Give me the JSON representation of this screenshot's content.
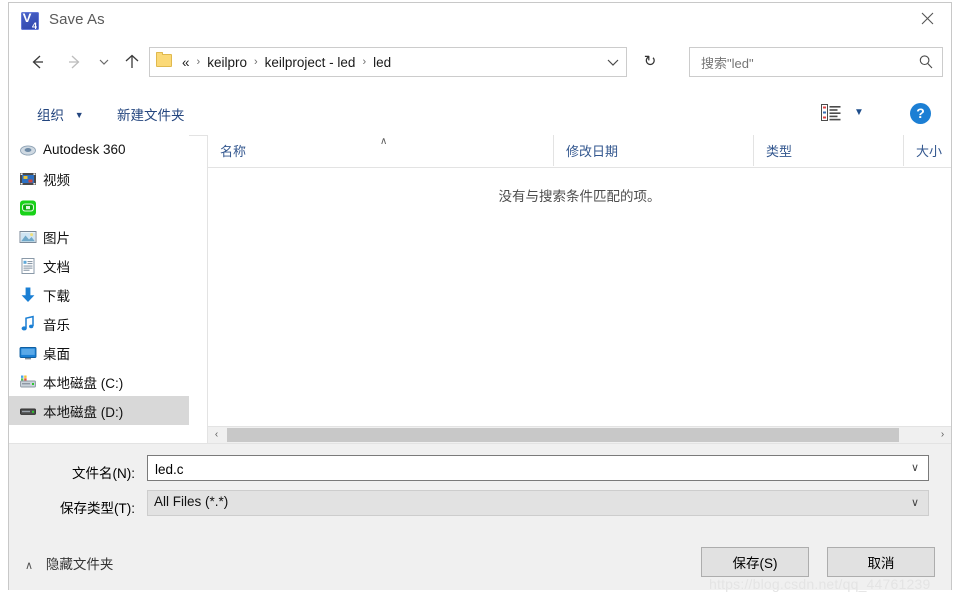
{
  "window": {
    "title": "Save As",
    "app_icon": "keil-uvision-icon",
    "close_label": "✕"
  },
  "nav": {
    "back_icon": "arrow-left-icon",
    "forward_icon": "arrow-right-icon",
    "recent_icon": "chevron-down-icon",
    "up_icon": "arrow-up-icon",
    "refresh_icon": "↻",
    "address_dropdown_icon": "chevron-down-icon",
    "folder_icon": "folder-icon",
    "breadcrumb_prefix": "«",
    "breadcrumb": [
      "keilpro",
      "keilproject - led",
      "led"
    ],
    "breadcrumb_separator": "›"
  },
  "search": {
    "placeholder": "搜索\"led\"",
    "value": "",
    "icon": "search-icon"
  },
  "toolbar": {
    "organize_label": "组织",
    "organize_caret": "▼",
    "new_folder_label": "新建文件夹",
    "view_icon": "list-view-icon",
    "view_caret": "▼",
    "help_label": "?"
  },
  "sidebar": {
    "items": [
      {
        "label": "Autodesk 360",
        "icon": "autodesk-cloud-icon",
        "selected": false
      },
      {
        "label": "视频",
        "icon": "videos-icon",
        "selected": false
      },
      {
        "label": "",
        "icon": "green-app-icon",
        "selected": false
      },
      {
        "label": "图片",
        "icon": "pictures-icon",
        "selected": false
      },
      {
        "label": "文档",
        "icon": "documents-icon",
        "selected": false
      },
      {
        "label": "下载",
        "icon": "downloads-icon",
        "selected": false
      },
      {
        "label": "音乐",
        "icon": "music-icon",
        "selected": false
      },
      {
        "label": "桌面",
        "icon": "desktop-icon",
        "selected": false
      },
      {
        "label": "本地磁盘 (C:)",
        "icon": "system-drive-icon",
        "selected": false
      },
      {
        "label": "本地磁盘 (D:)",
        "icon": "local-drive-icon",
        "selected": true
      }
    ],
    "scroll_up_icon": "∧",
    "scroll_down_icon": "∨"
  },
  "file_list": {
    "columns": [
      {
        "label": "名称",
        "sorted": "asc",
        "sort_caret": "∧"
      },
      {
        "label": "修改日期",
        "sorted": "",
        "sort_caret": ""
      },
      {
        "label": "类型",
        "sorted": "",
        "sort_caret": ""
      },
      {
        "label": "大小",
        "sorted": "",
        "sort_caret": ""
      }
    ],
    "rows": [],
    "empty_message": "没有与搜索条件匹配的项。",
    "scroll_left_icon": "‹",
    "scroll_right_icon": "›"
  },
  "form": {
    "filename_label": "文件名(N):",
    "filename_value": "led.c",
    "filetype_label": "保存类型(T):",
    "filetype_value": "All Files (*.*)",
    "dropdown_icon": "∨"
  },
  "footer": {
    "hide_folders_label": "隐藏文件夹",
    "hide_folders_caret": "∧",
    "save_label": "保存(S)",
    "cancel_label": "取消"
  },
  "watermark": {
    "text": "https://blog.csdn.net/qq_44761239"
  },
  "colors": {
    "accent_blue": "#24467f",
    "help_blue": "#1c7fd4",
    "selection_gray": "#d8d8d8",
    "panel_gray": "#f0f0f0"
  }
}
